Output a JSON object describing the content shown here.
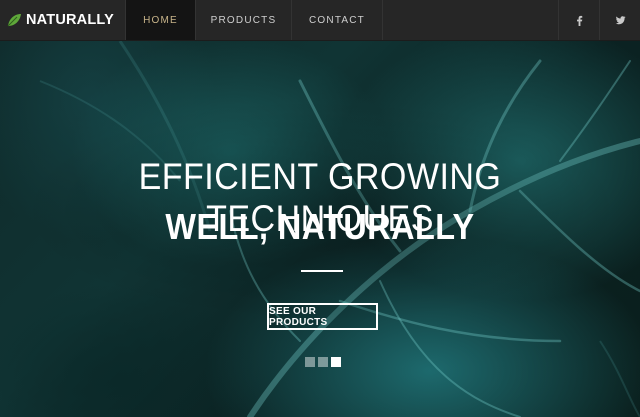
{
  "brand": {
    "name": "NATURALLY",
    "logo_icon": "leaf-icon",
    "leaf_color": "#5fa83a"
  },
  "nav": {
    "items": [
      {
        "label": "HOME",
        "active": true
      },
      {
        "label": "PRODUCTS",
        "active": false
      },
      {
        "label": "CONTACT",
        "active": false
      }
    ],
    "social": [
      {
        "icon": "facebook-icon"
      },
      {
        "icon": "twitter-icon"
      }
    ]
  },
  "hero": {
    "headline": "EFFICIENT GROWING TECHNIQUES",
    "subheadline": "WELL, NATURALLY",
    "cta_label": "SEE OUR PRODUCTS",
    "slides": {
      "count": 3,
      "active_index": 2
    }
  },
  "colors": {
    "navbar_bg": "#262626",
    "active_nav_text": "#c8b48a",
    "hero_tint": "#1f7b7c"
  }
}
